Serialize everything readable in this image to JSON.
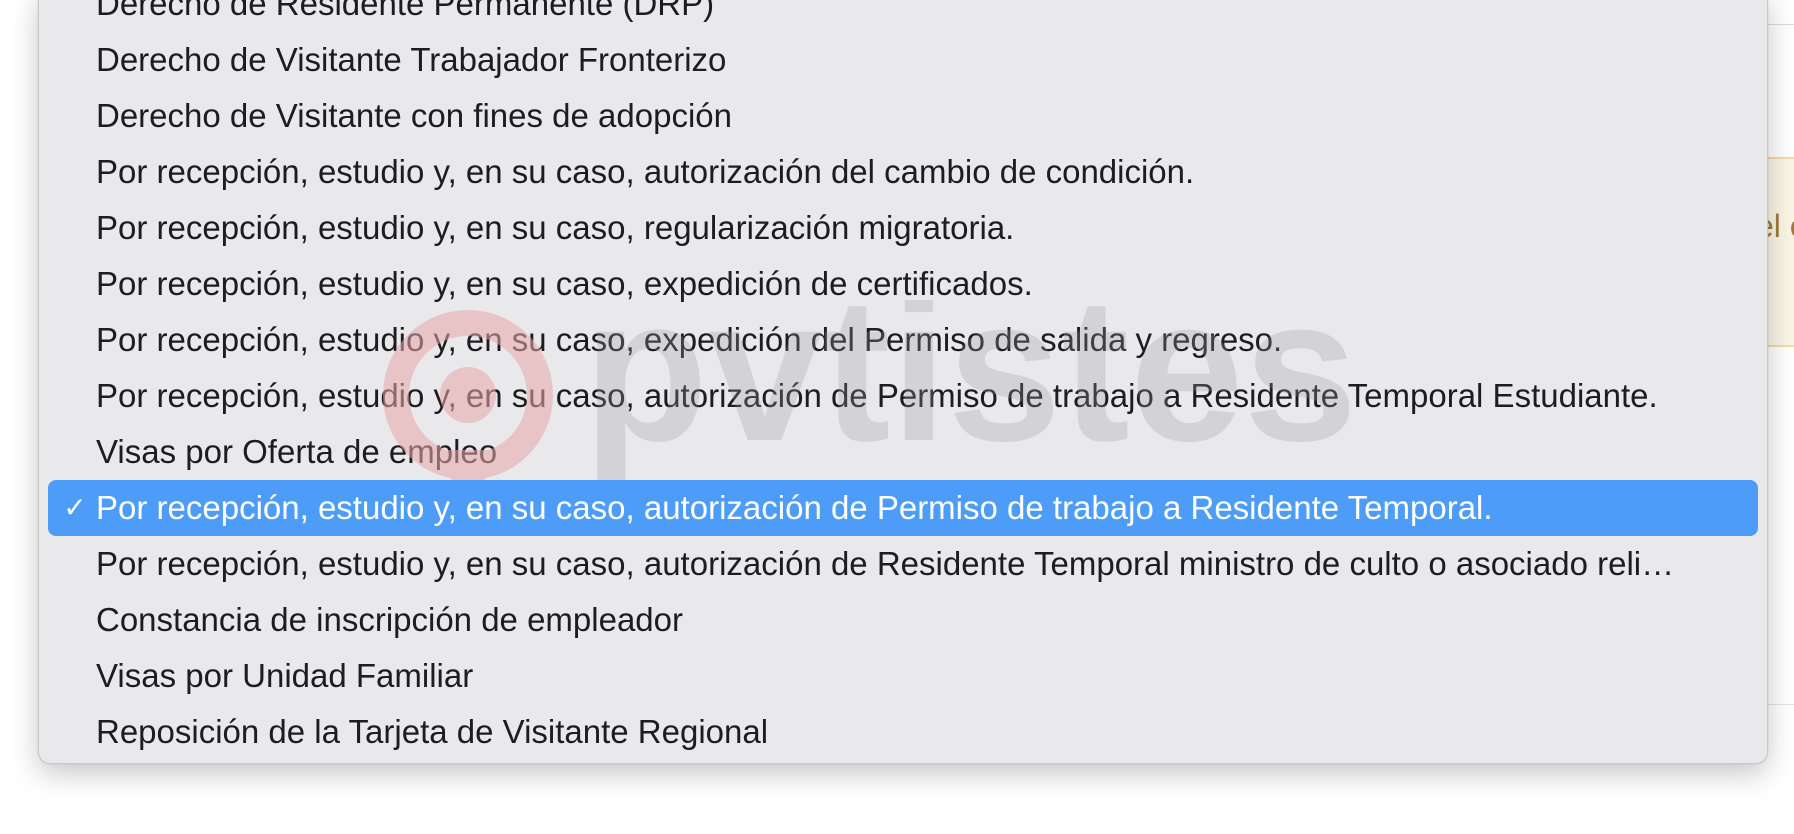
{
  "menu": {
    "items": [
      {
        "label": "Derecho de Residente Permanente (DRP)",
        "selected": false
      },
      {
        "label": "Derecho de Visitante Trabajador Fronterizo",
        "selected": false
      },
      {
        "label": "Derecho de Visitante con fines de adopción",
        "selected": false
      },
      {
        "label": "Por recepción, estudio y, en su caso, autorización del cambio de condición.",
        "selected": false
      },
      {
        "label": "Por recepción, estudio y, en su caso, regularización migratoria.",
        "selected": false
      },
      {
        "label": "Por recepción, estudio y, en su caso, expedición de certificados.",
        "selected": false
      },
      {
        "label": "Por recepción, estudio y, en su caso, expedición del Permiso de salida y regreso.",
        "selected": false
      },
      {
        "label": "Por recepción, estudio y, en su caso, autorización de Permiso de trabajo a Residente Temporal Estudiante.",
        "selected": false
      },
      {
        "label": "Visas por Oferta de empleo",
        "selected": false
      },
      {
        "label": "Por recepción, estudio y, en su caso, autorización de Permiso de trabajo a Residente Temporal.",
        "selected": true
      },
      {
        "label": "Por recepción, estudio y, en su caso, autorización de Residente Temporal ministro de culto o asociado reli…",
        "selected": false
      },
      {
        "label": "Constancia de inscripción de empleador",
        "selected": false
      },
      {
        "label": "Visas por Unidad Familiar",
        "selected": false
      },
      {
        "label": "Reposición de la Tarjeta de Visitante Regional",
        "selected": false
      }
    ],
    "check_mark": "✓",
    "selected_color": "#4d9df8"
  },
  "background": {
    "notice_fragment": "el e"
  },
  "watermark": {
    "text": "pvtistes",
    "icon": "location-pin-icon"
  }
}
